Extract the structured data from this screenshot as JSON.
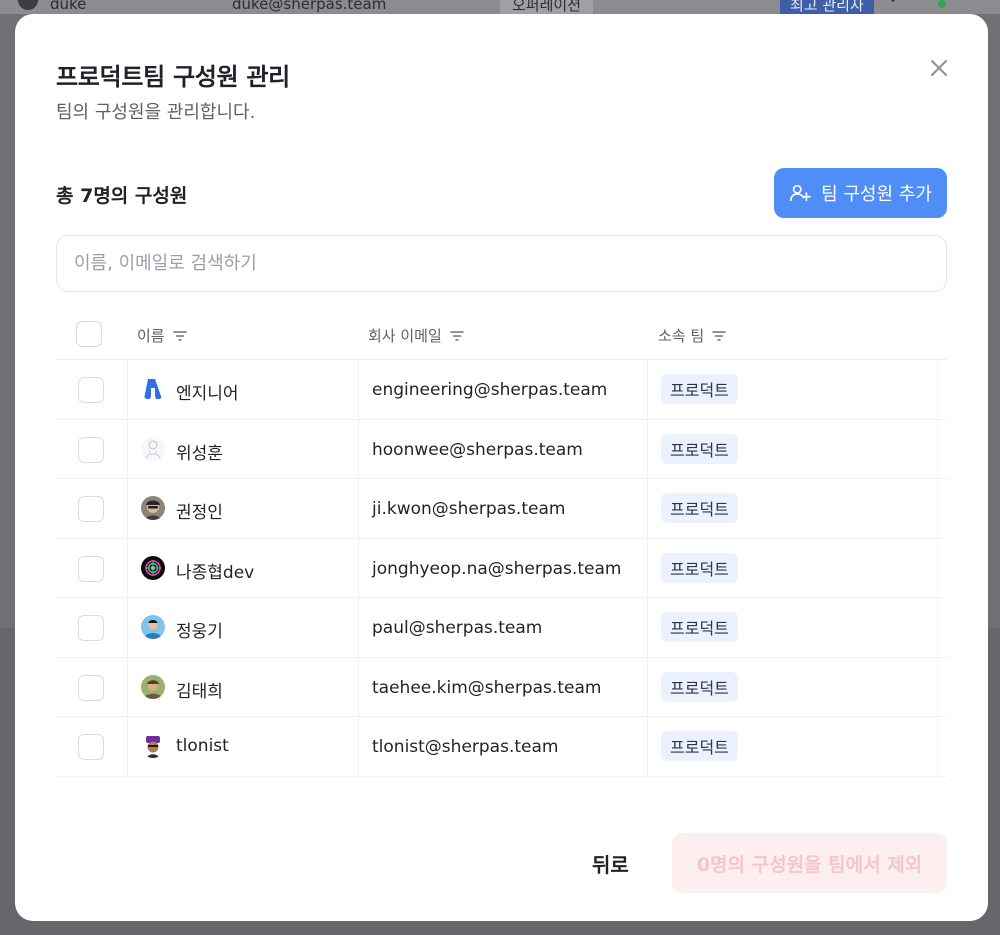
{
  "background": {
    "name": "duke",
    "email": "duke@sherpas.team",
    "team": "오퍼레이션",
    "role": "최고 관리자"
  },
  "modal": {
    "title": "프로덕트팀 구성원 관리",
    "subtitle": "팀의 구성원을 관리합니다.",
    "member_count_label": "총 7명의 구성원",
    "add_button_label": "팀 구성원 추가",
    "search_placeholder": "이름, 이메일로 검색하기",
    "columns": {
      "name": "이름",
      "email": "회사 이메일",
      "team": "소속 팀"
    },
    "members": [
      {
        "name": "엔지니어",
        "email": "engineering@sherpas.team",
        "team": "프로덕트",
        "avatar": "brand-logo-icon"
      },
      {
        "name": "위성훈",
        "email": "hoonwee@sherpas.team",
        "team": "프로덕트",
        "avatar": "sketch-avatar"
      },
      {
        "name": "권정인",
        "email": "ji.kwon@sherpas.team",
        "team": "프로덕트",
        "avatar": "photo-avatar"
      },
      {
        "name": "나종협dev",
        "email": "jonghyeop.na@sherpas.team",
        "team": "프로덕트",
        "avatar": "neon-avatar"
      },
      {
        "name": "정웅기",
        "email": "paul@sherpas.team",
        "team": "프로덕트",
        "avatar": "photo-avatar"
      },
      {
        "name": "김태희",
        "email": "taehee.kim@sherpas.team",
        "team": "프로덕트",
        "avatar": "photo-avatar"
      },
      {
        "name": "tlonist",
        "email": "tlonist@sherpas.team",
        "team": "프로덕트",
        "avatar": "photo-avatar"
      }
    ],
    "back_button_label": "뒤로",
    "remove_button_label": "0명의 구성원을 팀에서 제외"
  },
  "colors": {
    "primary": "#4f8df7",
    "badge_bg": "#ecf2fd",
    "danger_disabled_bg": "#fdeff0",
    "danger_disabled_text": "#f6c5ca"
  }
}
